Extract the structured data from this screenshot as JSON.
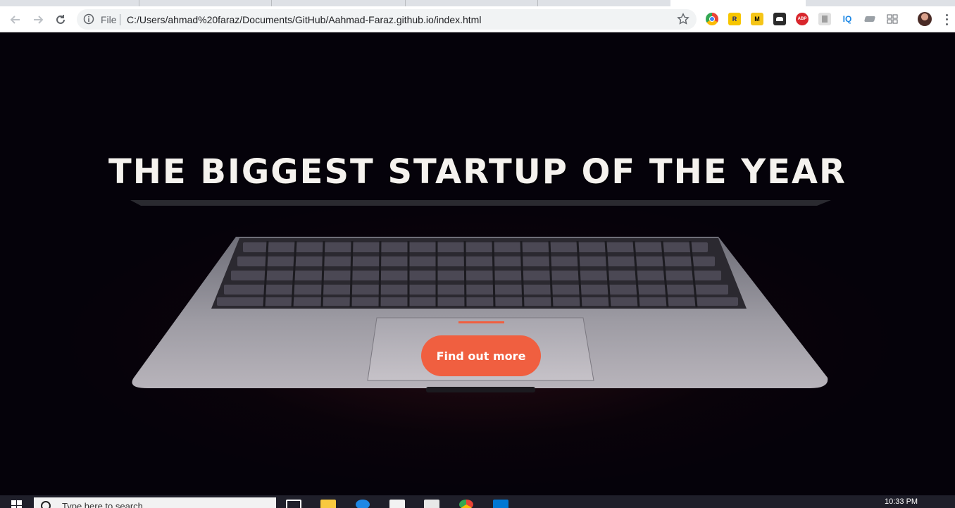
{
  "browser": {
    "omnibox": {
      "scheme_label": "File",
      "url": "C:/Users/ahmad%20faraz/Documents/GitHub/Aahmad-Faraz.github.io/index.html"
    },
    "extensions": [
      {
        "icon": "color-picker-icon",
        "color": "#4285f4",
        "text": ""
      },
      {
        "icon": "notes-icon",
        "color": "#f7c600",
        "text": "R"
      },
      {
        "icon": "mega-icon",
        "color": "#f5c518",
        "text": "M"
      },
      {
        "icon": "ghost-icon",
        "color": "#2b2b2b",
        "text": ""
      },
      {
        "icon": "adblock-plus-icon",
        "color": "#d8262c",
        "text": "ABP"
      },
      {
        "icon": "pdf-icon",
        "color": "#9e9e9e",
        "text": ""
      },
      {
        "icon": "iq-icon",
        "color": "#ffffff",
        "text": "IQ"
      },
      {
        "icon": "cast-icon",
        "color": "#9aa0a6",
        "text": ""
      },
      {
        "icon": "tab-grid-icon",
        "color": "#ffffff",
        "text": ""
      }
    ]
  },
  "hero": {
    "headline": "THE BIGGEST STARTUP OF THE YEAR",
    "cta_label": "Find out more",
    "accent_color": "#f05f40"
  },
  "taskbar": {
    "search_placeholder": "Type here to search",
    "clock": "10:33 PM",
    "apps": [
      "task-view-icon",
      "file-explorer-icon",
      "edge-icon",
      "mail-icon",
      "store-icon",
      "chrome-icon",
      "vscode-icon"
    ]
  }
}
